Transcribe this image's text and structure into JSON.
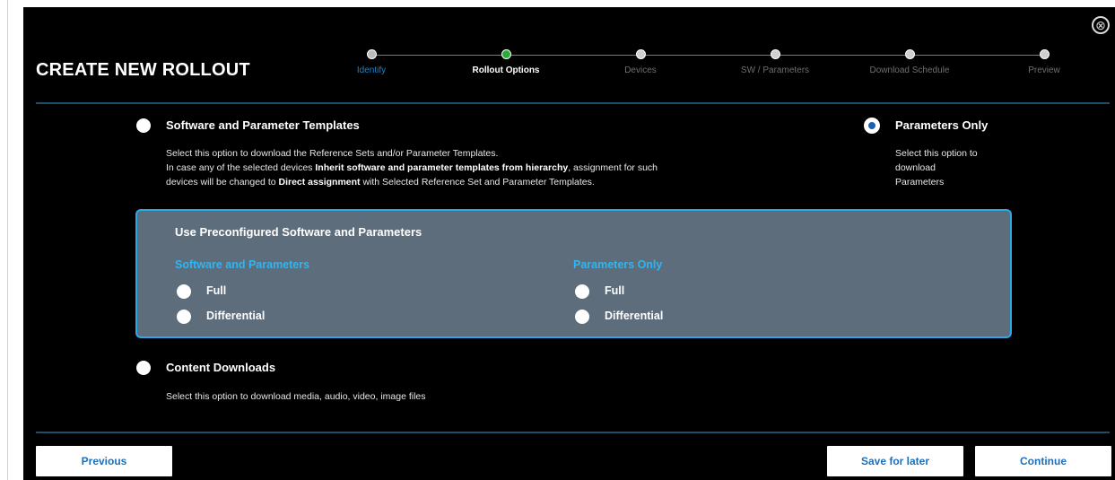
{
  "header": {
    "title": "CREATE NEW ROLLOUT",
    "close_glyph": "⊗"
  },
  "stepper": {
    "steps": [
      {
        "label": "Identify",
        "state": "done"
      },
      {
        "label": "Rollout Options",
        "state": "current"
      },
      {
        "label": "Devices",
        "state": "pending"
      },
      {
        "label": "SW / Parameters",
        "state": "pending"
      },
      {
        "label": "Download Schedule",
        "state": "pending"
      },
      {
        "label": "Preview",
        "state": "pending"
      }
    ]
  },
  "options": {
    "sw_param_templates": {
      "title": "Software and Parameter Templates",
      "desc_line1": "Select this option to download the Reference Sets and/or Parameter Templates.",
      "desc_line2_a": "In case any of the selected devices ",
      "desc_line2_b": "Inherit software and parameter templates from hierarchy",
      "desc_line2_c": ", assignment for such",
      "desc_line3_a": "devices will be changed to ",
      "desc_line3_b": "Direct assignment",
      "desc_line3_c": " with Selected Reference Set and Parameter Templates.",
      "selected": false
    },
    "parameters_only": {
      "title": "Parameters Only",
      "desc_line1": "Select this option to",
      "desc_line2": "download",
      "desc_line3": "Parameters",
      "selected": true
    },
    "preconfigured": {
      "title": "Use Preconfigured Software and Parameters",
      "sw_group_title": "Software and Parameters",
      "param_group_title": "Parameters Only",
      "full_label": "Full",
      "differential_label": "Differential"
    },
    "content_downloads": {
      "title": "Content Downloads",
      "desc": "Select this option to download media, audio, video, image files",
      "selected": false
    }
  },
  "footer": {
    "previous_label": "Previous",
    "save_label": "Save for later",
    "continue_label": "Continue"
  },
  "colors": {
    "background": "#000000",
    "accent": "#2fb6f2",
    "active_step": "#2cab3a",
    "panel": "#5d6d7c",
    "button_text": "#1f6fb8"
  }
}
